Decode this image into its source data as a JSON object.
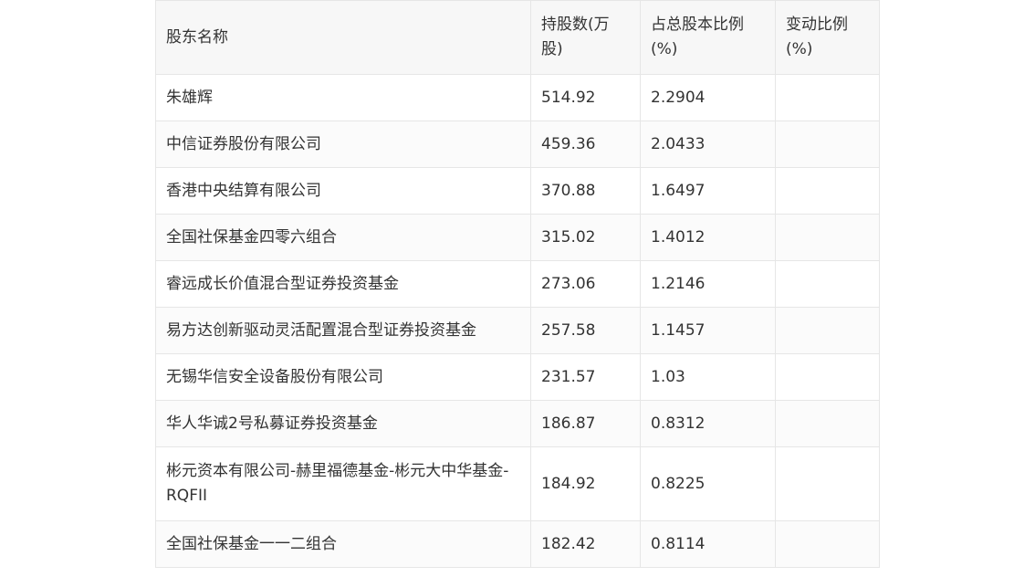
{
  "table": {
    "headers": [
      "股东名称",
      "持股数(万股)",
      "占总股本比例(%)",
      "变动比例(%)"
    ],
    "rows": [
      {
        "name": "朱雄辉",
        "shares": "514.92",
        "ratio": "2.2904",
        "change": ""
      },
      {
        "name": "中信证券股份有限公司",
        "shares": "459.36",
        "ratio": "2.0433",
        "change": ""
      },
      {
        "name": "香港中央结算有限公司",
        "shares": "370.88",
        "ratio": "1.6497",
        "change": ""
      },
      {
        "name": "全国社保基金四零六组合",
        "shares": "315.02",
        "ratio": "1.4012",
        "change": ""
      },
      {
        "name": "睿远成长价值混合型证券投资基金",
        "shares": "273.06",
        "ratio": "1.2146",
        "change": ""
      },
      {
        "name": "易方达创新驱动灵活配置混合型证券投资基金",
        "shares": "257.58",
        "ratio": "1.1457",
        "change": ""
      },
      {
        "name": "无锡华信安全设备股份有限公司",
        "shares": "231.57",
        "ratio": "1.03",
        "change": ""
      },
      {
        "name": "华人华诚2号私募证券投资基金",
        "shares": "186.87",
        "ratio": "0.8312",
        "change": ""
      },
      {
        "name": "彬元资本有限公司-赫里福德基金-彬元大中华基金-RQFII",
        "shares": "184.92",
        "ratio": "0.8225",
        "change": ""
      },
      {
        "name": "全国社保基金一一二组合",
        "shares": "182.42",
        "ratio": "0.8114",
        "change": ""
      }
    ]
  }
}
